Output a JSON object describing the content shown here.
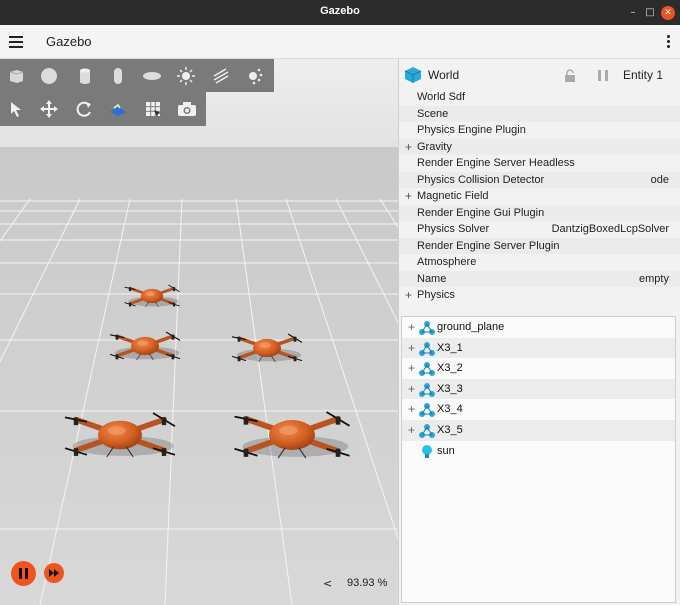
{
  "window": {
    "title": "Gazebo"
  },
  "appbar": {
    "title": "Gazebo"
  },
  "shape_toolbar": [
    {
      "name": "box-icon"
    },
    {
      "name": "sphere-icon"
    },
    {
      "name": "cylinder-icon"
    },
    {
      "name": "capsule-icon"
    },
    {
      "name": "ellipsoid-icon"
    },
    {
      "name": "sun-light-icon"
    },
    {
      "name": "directional-light-icon"
    },
    {
      "name": "spot-light-icon"
    }
  ],
  "tool_toolbar": [
    {
      "name": "select-arrow-icon"
    },
    {
      "name": "translate-icon"
    },
    {
      "name": "rotate-icon"
    },
    {
      "name": "snap-icon"
    },
    {
      "name": "grid-icon"
    },
    {
      "name": "camera-icon"
    }
  ],
  "playback": {
    "rtf_arrow": "<",
    "rtf": "93.93 %"
  },
  "component_inspector": {
    "entity_name": "World",
    "entity_id": "Entity 1",
    "properties": [
      {
        "name": "World Sdf",
        "value": "",
        "expandable": false
      },
      {
        "name": "Scene",
        "value": "",
        "expandable": false
      },
      {
        "name": "Physics Engine Plugin",
        "value": "",
        "expandable": false
      },
      {
        "name": "Gravity",
        "value": "",
        "expandable": true
      },
      {
        "name": "Render Engine Server Headless",
        "value": "",
        "expandable": false
      },
      {
        "name": "Physics Collision Detector",
        "value": "ode",
        "expandable": false
      },
      {
        "name": "Magnetic Field",
        "value": "",
        "expandable": true
      },
      {
        "name": "Render Engine Gui Plugin",
        "value": "",
        "expandable": false
      },
      {
        "name": "Physics Solver",
        "value": "DantzigBoxedLcpSolver",
        "expandable": false
      },
      {
        "name": "Render Engine Server Plugin",
        "value": "",
        "expandable": false
      },
      {
        "name": "Atmosphere",
        "value": "",
        "expandable": false
      },
      {
        "name": "Name",
        "value": "empty",
        "expandable": false
      },
      {
        "name": "Physics",
        "value": "",
        "expandable": true
      }
    ]
  },
  "entity_tree": [
    {
      "label": "ground_plane",
      "icon": "model-icon",
      "expandable": true
    },
    {
      "label": "X3_1",
      "icon": "model-icon",
      "expandable": true
    },
    {
      "label": "X3_2",
      "icon": "model-icon",
      "expandable": true
    },
    {
      "label": "X3_3",
      "icon": "model-icon",
      "expandable": true
    },
    {
      "label": "X3_4",
      "icon": "model-icon",
      "expandable": true
    },
    {
      "label": "X3_5",
      "icon": "model-icon",
      "expandable": true
    },
    {
      "label": "sun",
      "icon": "light-bulb-icon",
      "expandable": false
    }
  ],
  "colors": {
    "accent": "#f0541e",
    "drone": "#d8652a",
    "world_icon": "#2aa8d8"
  }
}
